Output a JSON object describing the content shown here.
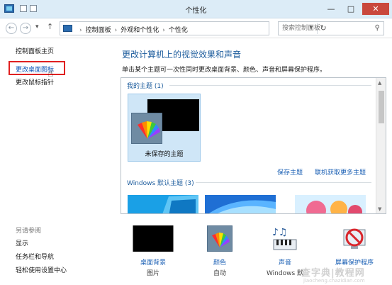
{
  "window": {
    "title": "个性化",
    "minimize": "—",
    "maximize": "□",
    "close": "✕"
  },
  "nav": {
    "back": "←",
    "forward": "→",
    "dropdown": "▾",
    "up": "↑",
    "breadcrumbs": [
      "控制面板",
      "外观和个性化",
      "个性化"
    ],
    "refresh": "↻",
    "search_placeholder": "搜索控制面板"
  },
  "sidebar": {
    "home": "控制面板主页",
    "change_desktop_icons": "更改桌面图标",
    "change_mouse_pointers": "更改鼠标指针",
    "see_also_heading": "另请参阅",
    "see_also": [
      "显示",
      "任务栏和导航",
      "轻松使用设置中心"
    ]
  },
  "main": {
    "heading": "更改计算机上的视觉效果和声音",
    "description": "单击某个主题可一次性同时更改桌面背景、颜色、声音和屏幕保护程序。",
    "my_themes_label": "我的主题 (1)",
    "unsaved_theme": "未保存的主题",
    "save_theme": "保存主题",
    "get_more_themes": "联机获取更多主题",
    "windows_default_label": "Windows 默认主题 (3)"
  },
  "bottom": [
    {
      "label": "桌面背景",
      "value": "图片"
    },
    {
      "label": "颜色",
      "value": "自动"
    },
    {
      "label": "声音",
      "value": "Windows 默"
    },
    {
      "label": "屏幕保护程序",
      "value": ""
    }
  ],
  "watermark": {
    "text": "查字典|教程网",
    "url": "jiaocheng.chazidian.com"
  },
  "colors": {
    "link": "#1a5fb4",
    "heading": "#1b5b9c",
    "highlight_box": "#e02020",
    "selected_theme": "#cfe6f7"
  }
}
